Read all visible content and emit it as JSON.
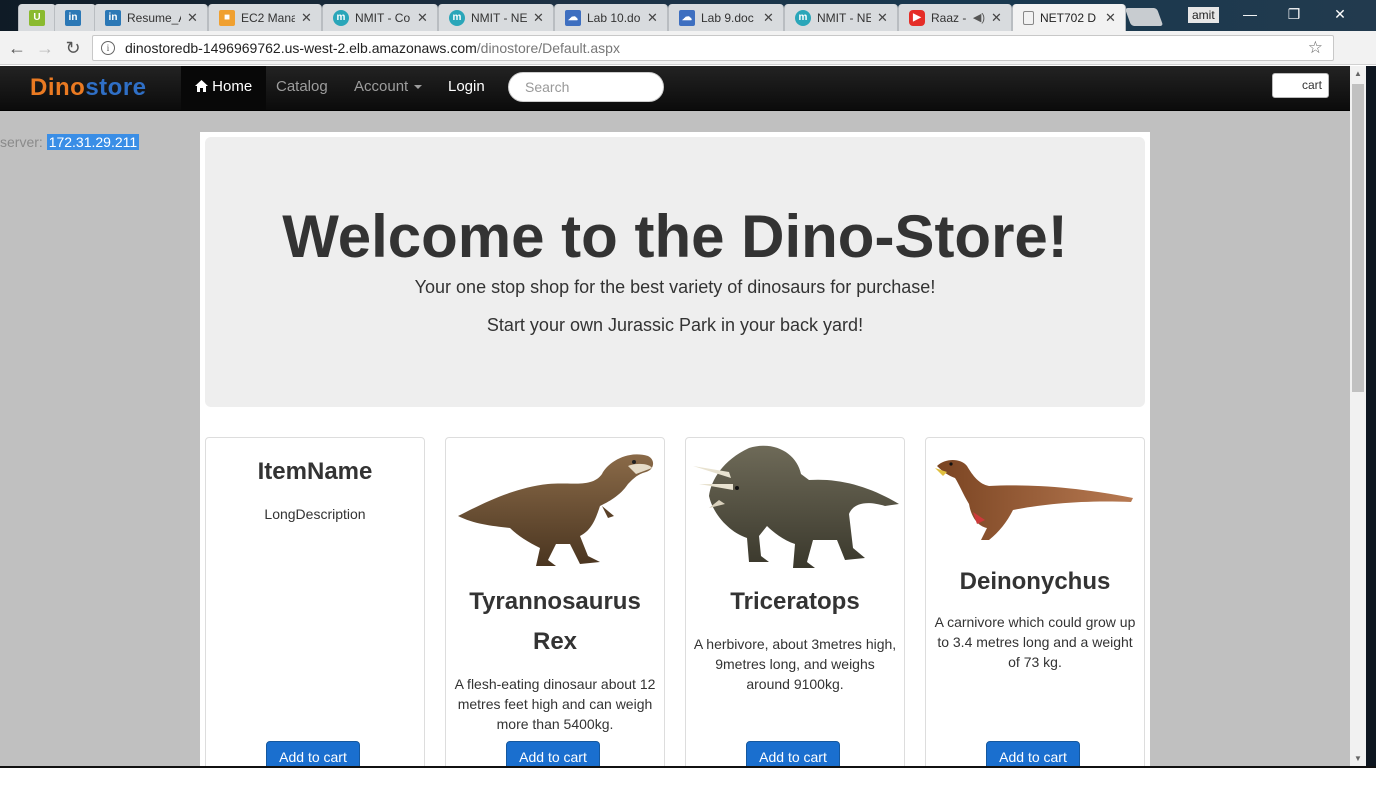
{
  "browser": {
    "tabs": [
      {
        "label": "",
        "icon": "upwork-icon",
        "color": "#8aba2f",
        "glyph": "U"
      },
      {
        "label": "",
        "icon": "linkedin-icon",
        "color": "#2b78b6",
        "glyph": "in"
      },
      {
        "label": "Resume_A",
        "icon": "linkedin-icon",
        "color": "#2b78b6",
        "glyph": "in"
      },
      {
        "label": "EC2 Mana",
        "icon": "aws-icon",
        "color": "#f0a030",
        "glyph": "■"
      },
      {
        "label": "NMIT - Co",
        "icon": "nmit-icon",
        "color": "#2aa6b9",
        "glyph": "m"
      },
      {
        "label": "NMIT - NE",
        "icon": "nmit-icon",
        "color": "#2aa6b9",
        "glyph": "m"
      },
      {
        "label": "Lab 10.do",
        "icon": "onedrive-icon",
        "color": "#3e6fc0",
        "glyph": "☁"
      },
      {
        "label": "Lab 9.doc",
        "icon": "onedrive-icon",
        "color": "#3e6fc0",
        "glyph": "☁"
      },
      {
        "label": "NMIT - NE",
        "icon": "nmit-icon",
        "color": "#2aa6b9",
        "glyph": "m"
      },
      {
        "label": "Raaz -",
        "icon": "youtube-icon",
        "color": "#e52d27",
        "glyph": "▶"
      },
      {
        "label": "NET702 D",
        "icon": "page-icon",
        "color": "#ffffff",
        "glyph": "▯"
      }
    ],
    "profile": "amit",
    "url_host": "dinostoredb-1496969762.us-west-2.elb.amazonaws.com",
    "url_path": "/dinostore/Default.aspx"
  },
  "navbar": {
    "brand_part1": "Dino",
    "brand_part2": "store",
    "home": "Home",
    "catalog": "Catalog",
    "account": "Account",
    "login": "Login",
    "search_placeholder": "Search",
    "cart": "cart"
  },
  "server": {
    "label": "server: ",
    "ip": "172.31.29.211"
  },
  "jumbotron": {
    "title": "Welcome to the Dino-Store!",
    "line1": "Your one stop shop for the best variety of dinosaurs for purchase!",
    "line2": "Start your own Jurassic Park in your back yard!"
  },
  "products": [
    {
      "name": "ItemName",
      "description": "LongDescription",
      "button": "Add to cart"
    },
    {
      "name": "Tyrannosaurus Rex",
      "description": "A flesh-eating dinosaur about 12 metres feet high and can weigh more than 5400kg.",
      "button": "Add to cart"
    },
    {
      "name": "Triceratops",
      "description": "A herbivore, about 3metres high, 9metres long, and weighs around 9100kg.",
      "button": "Add to cart"
    },
    {
      "name": "Deinonychus",
      "description": "A carnivore which could grow up to 3.4 metres long and a weight of 73 kg.",
      "button": "Add to cart"
    }
  ],
  "colors": {
    "brand_orange": "#ea7a22",
    "brand_blue": "#2f6fc6",
    "button_blue": "#1a6fcf",
    "selection": "#3a8ee6"
  }
}
